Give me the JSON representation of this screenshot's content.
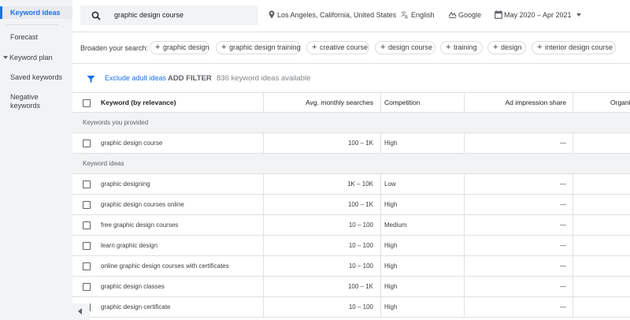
{
  "sidebar": {
    "items": [
      {
        "label": "Keyword ideas",
        "active": true
      },
      {
        "label": "Forecast"
      },
      {
        "label": "Keyword plan",
        "expandable": true
      },
      {
        "label": "Saved keywords"
      },
      {
        "label": "Negative keywords"
      }
    ]
  },
  "search": {
    "value": "graphic design course",
    "icon": "search-icon"
  },
  "location": {
    "label": "Los Angeles, California, United States",
    "icon": "location-pin-icon"
  },
  "language": {
    "label": "English",
    "icon": "translate-icon"
  },
  "network": {
    "label": "Google",
    "icon": "search-network-icon"
  },
  "daterange": {
    "label": "May 2020 – Apr 2021",
    "icon": "calendar-icon"
  },
  "broaden": {
    "label": "Broaden your search:",
    "chips": [
      "graphic design",
      "graphic design training",
      "creative course",
      "design course",
      "training",
      "design",
      "interior design course"
    ]
  },
  "filterbar": {
    "exclude_label": "Exclude adult ideas",
    "add_filter_label": "ADD FILTER",
    "count_label": "836 keyword ideas available"
  },
  "table": {
    "columns": {
      "keyword": "Keyword (by relevance)",
      "searches": "Avg. monthly searches",
      "competition": "Competition",
      "ad_impression": "Ad impression share",
      "organic": "Organic"
    },
    "groups": {
      "provided": "Keywords you provided",
      "ideas": "Keyword ideas"
    },
    "provided_rows": [
      {
        "keyword": "graphic design course",
        "searches": "100 – 1K",
        "competition": "High",
        "ad_impression": "—"
      }
    ],
    "idea_rows": [
      {
        "keyword": "graphic designing",
        "searches": "1K – 10K",
        "competition": "Low",
        "ad_impression": "—"
      },
      {
        "keyword": "graphic design courses online",
        "searches": "100 – 1K",
        "competition": "High",
        "ad_impression": "—"
      },
      {
        "keyword": "free graphic design courses",
        "searches": "10 – 100",
        "competition": "Medium",
        "ad_impression": "—"
      },
      {
        "keyword": "learn graphic design",
        "searches": "10 – 100",
        "competition": "High",
        "ad_impression": "—"
      },
      {
        "keyword": "online graphic design courses with certificates",
        "searches": "10 – 100",
        "competition": "High",
        "ad_impression": "—"
      },
      {
        "keyword": "graphic design classes",
        "searches": "100 – 1K",
        "competition": "High",
        "ad_impression": "—"
      },
      {
        "keyword": "graphic design certificate",
        "searches": "10 – 100",
        "competition": "High",
        "ad_impression": "—"
      }
    ]
  },
  "colors": {
    "accent": "#1a73e8",
    "sidebar_bg": "#f1f3f4",
    "group_bg": "#f1f3f4"
  }
}
